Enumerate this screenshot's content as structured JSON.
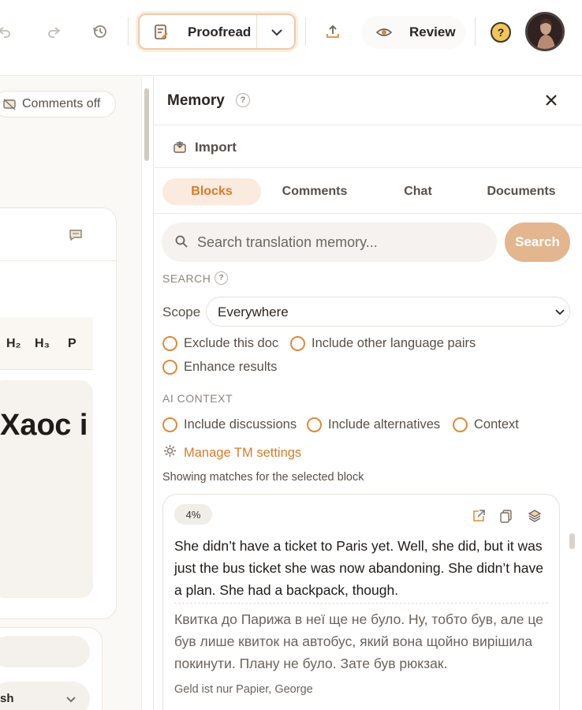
{
  "toolbar": {
    "proofread_label": "Proofread",
    "review_label": "Review",
    "help_label": "?"
  },
  "left_pane": {
    "comments_toggle": "Comments off",
    "headings": [
      "H₂",
      "H₃",
      "P"
    ],
    "editor_text": "Хаос i",
    "language_select": "sh"
  },
  "memory": {
    "title": "Memory",
    "title_help": "?",
    "import_label": "Import",
    "tabs": [
      {
        "label": "Blocks",
        "active": true
      },
      {
        "label": "Comments",
        "active": false
      },
      {
        "label": "Chat",
        "active": false
      },
      {
        "label": "Documents",
        "active": false
      }
    ],
    "search": {
      "placeholder": "Search translation memory...",
      "button": "Search"
    },
    "search_section": {
      "label": "SEARCH",
      "help": "?",
      "scope_label": "Scope",
      "scope_value": "Everywhere",
      "options": [
        "Exclude this doc",
        "Include other language pairs",
        "Enhance results"
      ]
    },
    "ai_context": {
      "label": "AI CONTEXT",
      "options": [
        "Include discussions",
        "Include alternatives",
        "Context"
      ],
      "manage_link": "Manage TM settings"
    },
    "status_text": "Showing matches for the selected block",
    "match": {
      "score": "4%",
      "source": "She didn’t have a ticket to Paris yet. Well, she did, but it was just the bus ticket she was now abandoning. She didn’t have a plan. She had a backpack, though.",
      "target": "Квитка до Парижа в неї ще не було. Ну, тобто був, але це був лише квиток на автобус, який вона щойно вирішила покинути. Плану не було. Зате був рюкзак.",
      "document": "Geld ist nur Papier, George"
    }
  },
  "colors": {
    "accent": "#d57c2c",
    "accent_soft": "#fbeade",
    "search_button": "#e3b68f",
    "radio": "#dd8a3e"
  },
  "icons": [
    "undo-icon",
    "redo-icon",
    "history-icon",
    "proofread-doc-icon",
    "chevron-down-icon",
    "upload-icon",
    "eye-icon",
    "help-icon",
    "close-icon",
    "import-icon",
    "search-icon",
    "gear-icon",
    "open-external-icon",
    "copy-icon",
    "layers-icon",
    "comment-icon"
  ]
}
